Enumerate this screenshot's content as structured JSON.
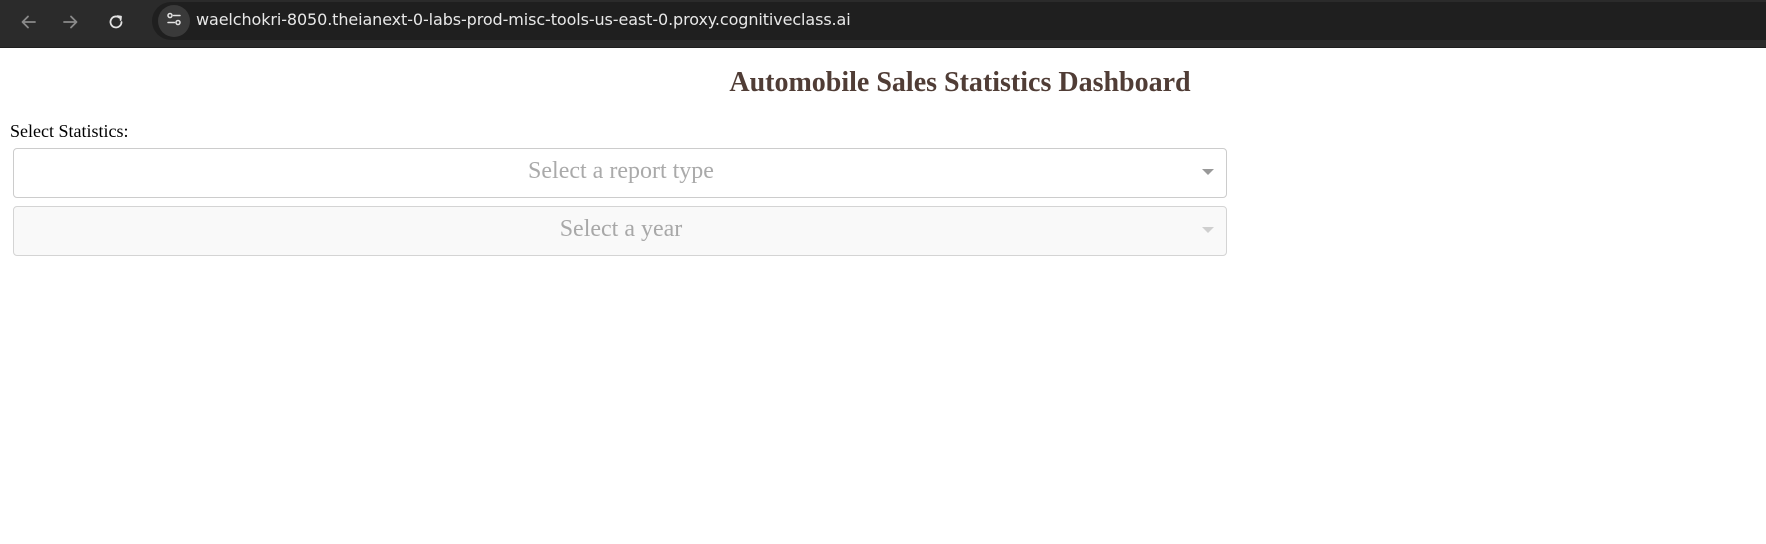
{
  "browser": {
    "url": "waelchokri-8050.theianext-0-labs-prod-misc-tools-us-east-0.proxy.cognitiveclass.ai",
    "icons": {
      "back": "arrow-left-icon",
      "forward": "arrow-right-icon",
      "reload": "reload-icon",
      "site_info": "tune-icon"
    }
  },
  "page": {
    "title": "Automobile Sales Statistics Dashboard",
    "select_label": "Select Statistics:",
    "report_dropdown": {
      "placeholder": "Select a report type",
      "value": "",
      "disabled": false
    },
    "year_dropdown": {
      "placeholder": "Select a year",
      "value": "",
      "disabled": true
    }
  },
  "colors": {
    "title": "#503d36",
    "browser_bar": "#2b2b2b",
    "placeholder": "#aaaaaa"
  }
}
